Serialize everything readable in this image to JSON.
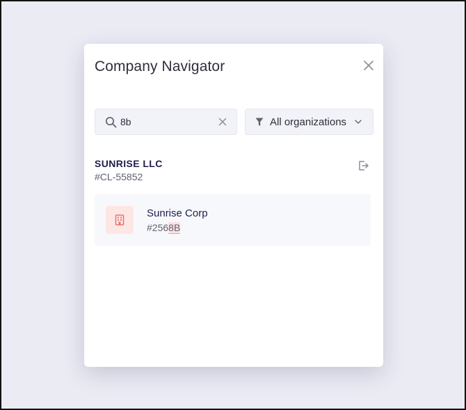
{
  "colors": {
    "backdrop": "#ebebf4",
    "modal_bg": "#ffffff",
    "title_text": "#2d2f3c",
    "primary_text": "#1f1c4d",
    "secondary_text": "#5f6270",
    "icon_gray": "#8a8c99",
    "field_bg": "#f2f3f8",
    "item_bg": "#f7f8fb",
    "company_accent": "#e8746a",
    "company_accent_bg": "#fde7e5",
    "highlight_bg": "#fbe2e2"
  },
  "modal": {
    "title": "Company Navigator",
    "close_icon": "close-icon"
  },
  "search": {
    "value": "8b",
    "placeholder": "",
    "icon": "search-icon",
    "clear_icon": "clear-icon"
  },
  "filter": {
    "selected": "All organizations",
    "icon": "funnel-icon",
    "chevron": "chevron-down-icon"
  },
  "group": {
    "name": "SUNRISE LLC",
    "id": "#CL-55852",
    "action_icon": "sign-out-icon"
  },
  "results": [
    {
      "name": "Sunrise Corp",
      "id_prefix": "#256",
      "id_match": "8B",
      "icon": "building-icon"
    }
  ]
}
